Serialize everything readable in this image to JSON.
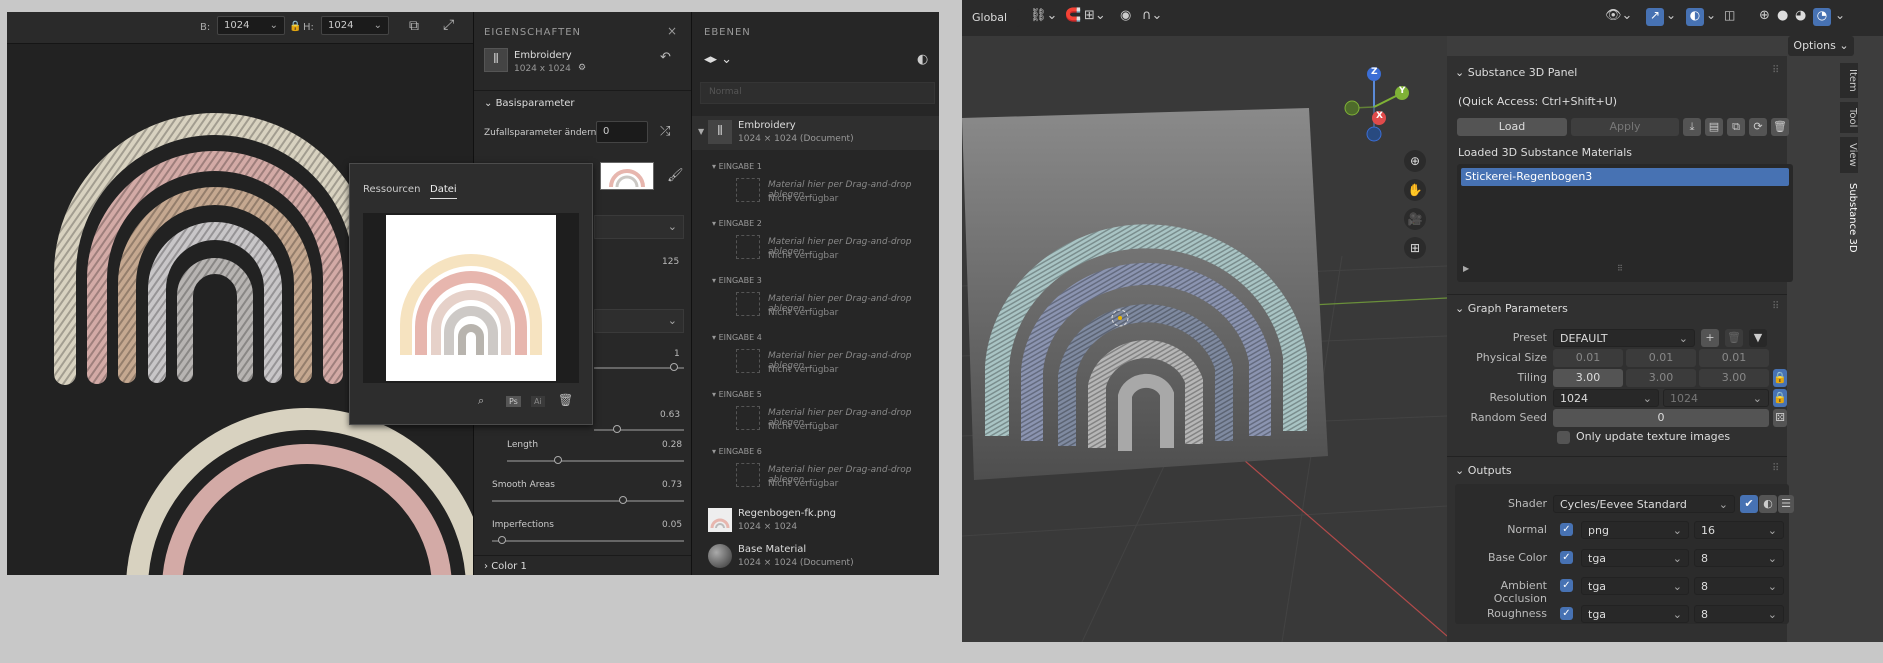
{
  "sd": {
    "toolbar": {
      "w_label": "B:",
      "w_value": "1024",
      "h_label": "H:",
      "h_value": "1024"
    },
    "properties": {
      "title": "EIGENSCHAFTEN",
      "doc_name": "Embroidery",
      "doc_size": "1024 x 1024",
      "base_section": "Basisparameter",
      "seed_label": "Zufallsparameter ändern",
      "seed_value": "0",
      "value_125": "125",
      "value_1": "1",
      "value_063": "0.63",
      "length_label": "Length",
      "length_value": "0.28",
      "smooth_label": "Smooth Areas",
      "smooth_value": "0.73",
      "imperf_label": "Imperfections",
      "imperf_value": "0.05",
      "color_section": "Color 1"
    },
    "popup": {
      "tab1": "Ressourcen",
      "tab2": "Datei"
    },
    "layers": {
      "title": "EBENEN",
      "search_placeholder": "Normal",
      "root_name": "Embroidery",
      "root_meta": "1024 × 1024 (Document)",
      "inputs": [
        {
          "label": "EINGABE 1",
          "hint": "Material hier per Drag-and-drop ablegen...",
          "status": "Nicht verfügbar"
        },
        {
          "label": "EINGABE 2",
          "hint": "Material hier per Drag-and-drop ablegen...",
          "status": "Nicht verfügbar"
        },
        {
          "label": "EINGABE 3",
          "hint": "Material hier per Drag-and-drop ablegen...",
          "status": "Nicht verfügbar"
        },
        {
          "label": "EINGABE 4",
          "hint": "Material hier per Drag-and-drop ablegen...",
          "status": "Nicht verfügbar"
        },
        {
          "label": "EINGABE 5",
          "hint": "Material hier per Drag-and-drop ablegen...",
          "status": "Nicht verfügbar"
        },
        {
          "label": "EINGABE 6",
          "hint": "Material hier per Drag-and-drop ablegen...",
          "status": "Nicht verfügbar"
        }
      ],
      "img_name": "Regenbogen-fk.png",
      "img_meta": "1024 × 1024",
      "base_name": "Base Material",
      "base_meta": "1024 × 1024 (Document)"
    }
  },
  "blender": {
    "topbar": {
      "orientation": "Global",
      "options": "Options"
    },
    "gizmo": {
      "z": "Z",
      "y": "Y",
      "x": "X"
    },
    "tabs": [
      "Item",
      "Tool",
      "View",
      "Substance 3D"
    ],
    "panel": {
      "title": "Substance 3D Panel",
      "quick_access": "(Quick Access: Ctrl+Shift+U)",
      "load": "Load",
      "apply": "Apply",
      "loaded_label": "Loaded 3D Substance Materials",
      "material": "Stickerei-Regenbogen3"
    },
    "graph": {
      "title": "Graph Parameters",
      "preset_label": "Preset",
      "preset_value": "DEFAULT",
      "physical_label": "Physical Size",
      "physical": [
        "0.01",
        "0.01",
        "0.01"
      ],
      "tiling_label": "Tiling",
      "tiling": [
        "3.00",
        "3.00",
        "3.00"
      ],
      "resolution_label": "Resolution",
      "resolution": [
        "1024",
        "1024"
      ],
      "seed_label": "Random Seed",
      "seed_value": "0",
      "only_update": "Only update texture images"
    },
    "outputs": {
      "title": "Outputs",
      "shader_label": "Shader",
      "shader_value": "Cycles/Eevee Standard",
      "rows": [
        {
          "label": "Normal",
          "format": "png",
          "bits": "16"
        },
        {
          "label": "Base Color",
          "format": "tga",
          "bits": "8"
        },
        {
          "label": "Ambient Occlusion",
          "format": "tga",
          "bits": "8"
        },
        {
          "label": "Roughness",
          "format": "tga",
          "bits": "8"
        }
      ]
    }
  }
}
